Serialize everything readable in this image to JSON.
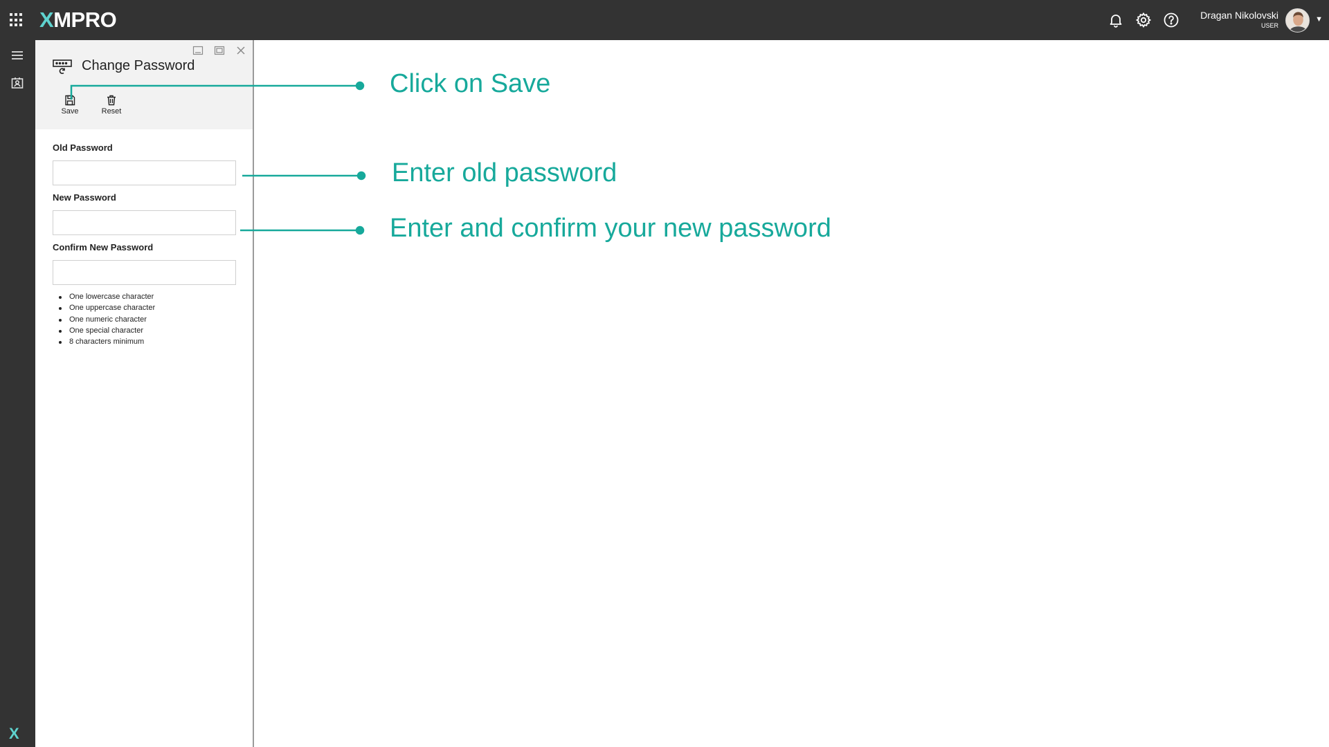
{
  "app": {
    "brand_prefix": "X",
    "brand_rest": "MPRO"
  },
  "header": {
    "user_name": "Dragan Nikolovski",
    "user_role": "USER",
    "caret": "▼",
    "icons": [
      "apps-grid-icon",
      "bell-icon",
      "gear-icon",
      "help-icon",
      "avatar",
      "chevron-down-icon"
    ]
  },
  "rail": {
    "icons": [
      "menu-icon",
      "contacts-icon",
      "xmpro-logo-icon"
    ],
    "bottom_logo": "X"
  },
  "panel": {
    "title": "Change Password",
    "toolbar": {
      "save_label": "Save",
      "reset_label": "Reset"
    },
    "fields": {
      "old_label": "Old Password",
      "new_label": "New Password",
      "confirm_label": "Confirm New Password"
    },
    "rules": [
      "One lowercase character",
      "One uppercase character",
      "One numeric character",
      "One special character",
      "8 characters minimum"
    ]
  },
  "annotations": {
    "save": "Click on Save",
    "old": "Enter old password",
    "new": "Enter and confirm your new password",
    "color": "#17a99b"
  },
  "colors": {
    "topbar": "#333333",
    "accent": "#5fd3cf",
    "panel_header": "#f2f2f2"
  }
}
